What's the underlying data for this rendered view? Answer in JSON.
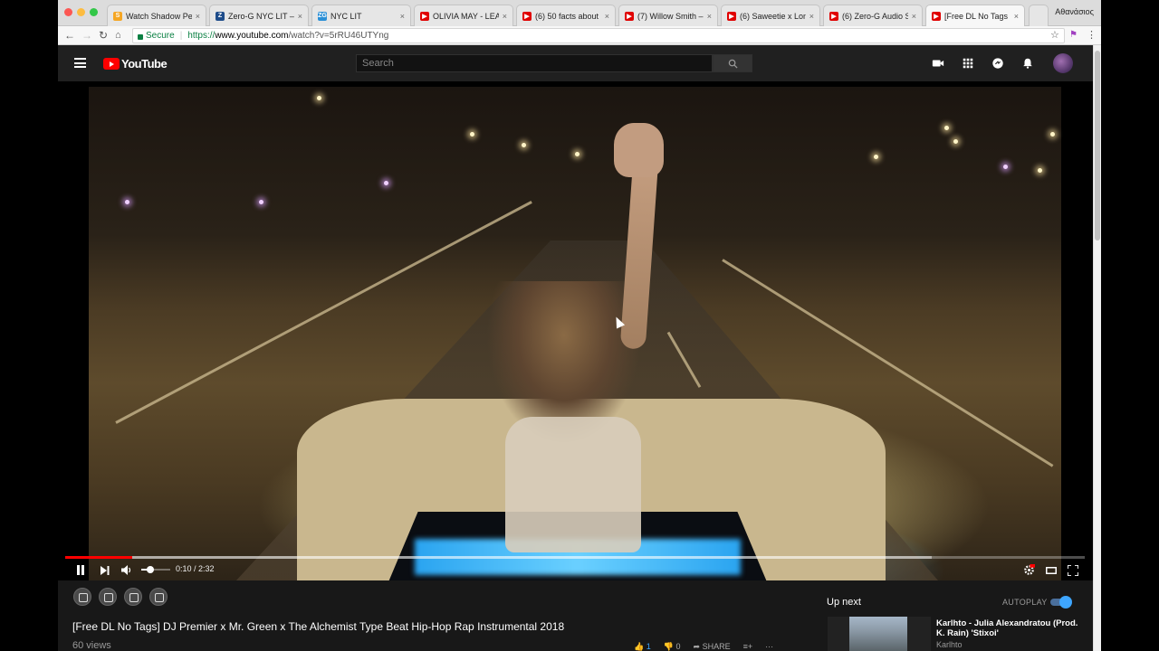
{
  "browser": {
    "tabs": [
      {
        "title": "Watch Shadow Peo",
        "icon": "s-favicon",
        "color": "#f5a623",
        "glyph": "S"
      },
      {
        "title": "Zero-G NYC LIT – ",
        "icon": "zg-favicon",
        "color": "#1e4c8a",
        "glyph": "Z"
      },
      {
        "title": "NYC LIT",
        "icon": "zg-favicon",
        "color": "#2a8fd6",
        "glyph": "ZG"
      },
      {
        "title": "OLIVIA MAY - LEAV",
        "icon": "youtube-favicon",
        "color": "#e00000",
        "glyph": "▶"
      },
      {
        "title": "(6) 50 facts about",
        "icon": "youtube-favicon",
        "color": "#e00000",
        "glyph": "▶"
      },
      {
        "title": "(7) Willow Smith –",
        "icon": "youtube-favicon",
        "color": "#e00000",
        "glyph": "▶"
      },
      {
        "title": "(6) Saweetie x Lon",
        "icon": "youtube-favicon",
        "color": "#e00000",
        "glyph": "▶"
      },
      {
        "title": "(6) Zero-G Audio S",
        "icon": "youtube-favicon",
        "color": "#e00000",
        "glyph": "▶"
      },
      {
        "title": "[Free DL No Tags",
        "icon": "youtube-favicon",
        "color": "#e00000",
        "glyph": "▶",
        "active": true
      }
    ],
    "profile_name": "Αθανάσιος",
    "secure_label": "Secure",
    "url_scheme": "https://",
    "url_host": "www.youtube.com",
    "url_path": "/watch?v=5rRU46UTYng"
  },
  "youtube": {
    "logo_text": "YouTube",
    "search_placeholder": "Search",
    "accent": "#ff0000"
  },
  "player": {
    "current_time": "0:10",
    "duration": "2:32",
    "time_display": "0:10 / 2:32",
    "played_fraction": 0.066,
    "loaded_fraction": 0.85,
    "volume_fraction": 0.3
  },
  "video": {
    "title": "[Free DL No Tags] DJ Premier x Mr. Green x The Alchemist Type Beat Hip-Hop Rap Instrumental 2018",
    "views": "60 views",
    "likes": "1",
    "dislikes": "0",
    "share_label": "SHARE"
  },
  "sidebar": {
    "up_next_label": "Up next",
    "autoplay_label": "AUTOPLAY",
    "autoplay_on": true,
    "recommendation": {
      "title": "Karlhto - Julia Alexandratou (Prod. K. Rain) 'Stixoi'",
      "channel": "Karlhto"
    }
  }
}
